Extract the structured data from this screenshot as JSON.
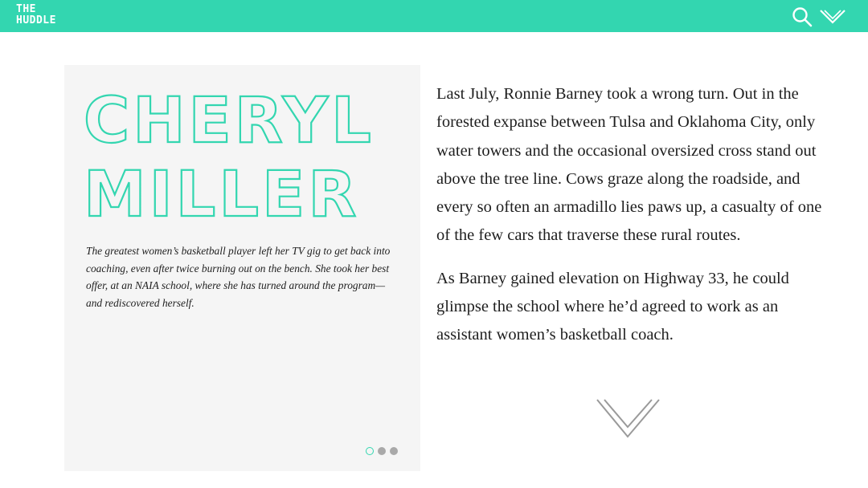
{
  "header": {
    "logo_line1": "THE",
    "logo_line2": "HUDDLE",
    "search_icon": "search-icon",
    "menu_icon": "chevron-down-icon",
    "accent_color": "#33d6b0"
  },
  "hero": {
    "title_line1": "CHERYL",
    "title_line2": "MILLER",
    "dek": "The greatest women’s basketball player left her TV gig to get back into coaching, even after twice burning out on the bench. She took her best offer, at an NAIA school, where she has turned around the program—and rediscovered herself.",
    "slides_total": 3,
    "slide_active": 1
  },
  "article": {
    "paragraphs": [
      "Last July, Ronnie Barney took a wrong turn. Out in the forested expanse between Tulsa and Oklahoma City, only water towers and the occasional oversized cross stand out above the tree line. Cows graze along the roadside, and every so often an armadillo lies paws up, a casualty of one of the few cars that traverse these rural routes.",
      "As Barney gained elevation on Highway 33, he could glimpse the school where he’d agreed to work as an assistant women’s basketball coach."
    ],
    "scroll_icon": "chevron-down-icon"
  }
}
